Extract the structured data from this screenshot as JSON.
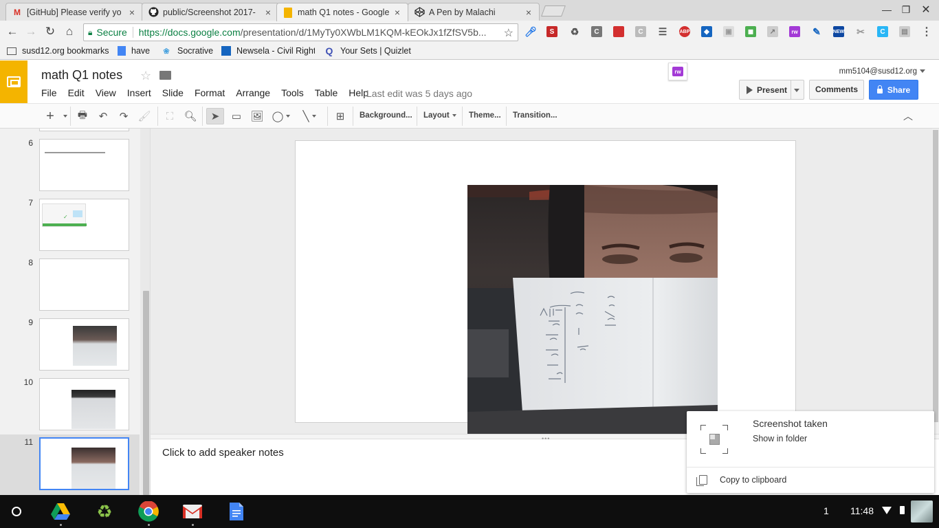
{
  "tabs": [
    {
      "title": "[GitHub] Please verify yo",
      "icon": "gmail-icon"
    },
    {
      "title": "public/Screenshot 2017-",
      "icon": "github-icon"
    },
    {
      "title": "math Q1 notes - Google",
      "icon": "slides-icon",
      "active": true
    },
    {
      "title": "A Pen by Malachi",
      "icon": "codepen-icon"
    }
  ],
  "omnibox": {
    "secure_label": "Secure",
    "url_host": "https://docs.google.com",
    "url_path": "/presentation/d/1MyTy0XWbLM1KQM-kEOkJx1fZfSV5b..."
  },
  "bookmarks": [
    {
      "label": "susd12.org bookmarks",
      "icon": "folder-icon"
    },
    {
      "label": "have",
      "icon": "doc-icon"
    },
    {
      "label": "Socrative",
      "icon": "socrative-icon"
    },
    {
      "label": "Newsela - Civil Rights",
      "icon": "newsela-icon"
    },
    {
      "label": "Your Sets | Quizlet",
      "icon": "quizlet-icon"
    }
  ],
  "app": {
    "title": "math Q1 notes",
    "menu": [
      "File",
      "Edit",
      "View",
      "Insert",
      "Slide",
      "Format",
      "Arrange",
      "Tools",
      "Table",
      "Help"
    ],
    "last_edit": "Last edit was 5 days ago",
    "account": "mm5104@susd12.org",
    "present_label": "Present",
    "comments_label": "Comments",
    "share_label": "Share",
    "brand_color": "#f4b400",
    "share_color": "#4285f4"
  },
  "toolbar": {
    "background_label": "Background...",
    "layout_label": "Layout",
    "theme_label": "Theme...",
    "transition_label": "Transition..."
  },
  "filmstrip": {
    "slides": [
      {
        "number": "6"
      },
      {
        "number": "7"
      },
      {
        "number": "8"
      },
      {
        "number": "9"
      },
      {
        "number": "10"
      },
      {
        "number": "11",
        "selected": true
      }
    ]
  },
  "notes": {
    "placeholder": "Click to add speaker notes"
  },
  "notification": {
    "title": "Screenshot taken",
    "subtitle": "Show in folder",
    "action": "Copy to clipboard"
  },
  "shelf": {
    "apps": [
      "drive-icon",
      "recycle-icon",
      "chrome-icon",
      "gmail-icon",
      "docs-icon"
    ],
    "notification_count": "1",
    "time": "11:48"
  }
}
